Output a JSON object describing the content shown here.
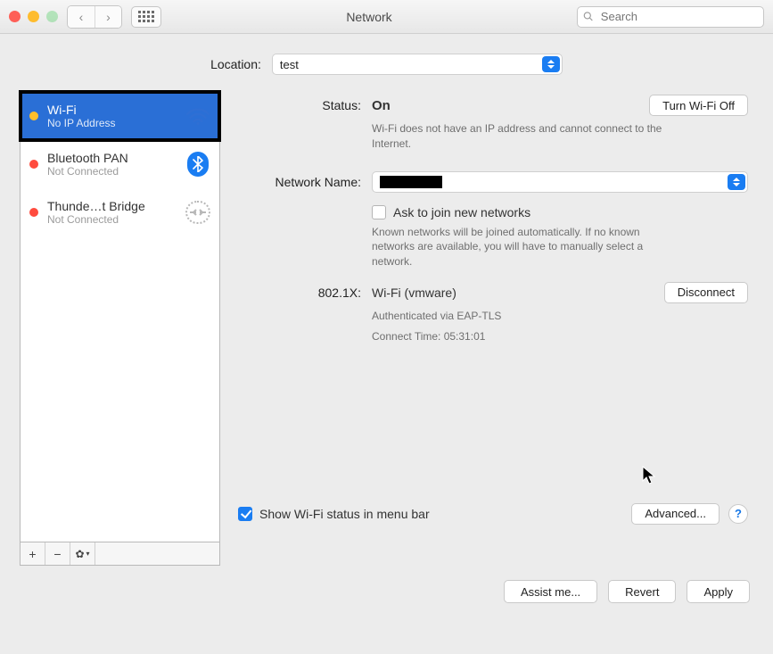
{
  "window": {
    "title": "Network"
  },
  "search": {
    "placeholder": "Search"
  },
  "location": {
    "label": "Location:",
    "value": "test"
  },
  "sidebar": {
    "items": [
      {
        "name": "Wi-Fi",
        "sub": "No IP Address"
      },
      {
        "name": "Bluetooth PAN",
        "sub": "Not Connected"
      },
      {
        "name": "Thunde…t Bridge",
        "sub": "Not Connected"
      }
    ]
  },
  "detail": {
    "status_label": "Status:",
    "status_value": "On",
    "wifi_off_btn": "Turn Wi-Fi Off",
    "status_desc": "Wi-Fi does not have an IP address and cannot connect to the Internet.",
    "network_name_label": "Network Name:",
    "ask_join_label": "Ask to join new networks",
    "ask_join_desc": "Known networks will be joined automatically. If no known networks are available, you will have to manually select a network.",
    "dot1x_label": "802.1X:",
    "dot1x_value": "Wi-Fi (vmware)",
    "disconnect_btn": "Disconnect",
    "dot1x_auth": "Authenticated via EAP-TLS",
    "dot1x_time": "Connect Time: 05:31:01",
    "show_menubar": "Show Wi-Fi status in menu bar",
    "advanced_btn": "Advanced..."
  },
  "footer": {
    "assist": "Assist me...",
    "revert": "Revert",
    "apply": "Apply"
  }
}
